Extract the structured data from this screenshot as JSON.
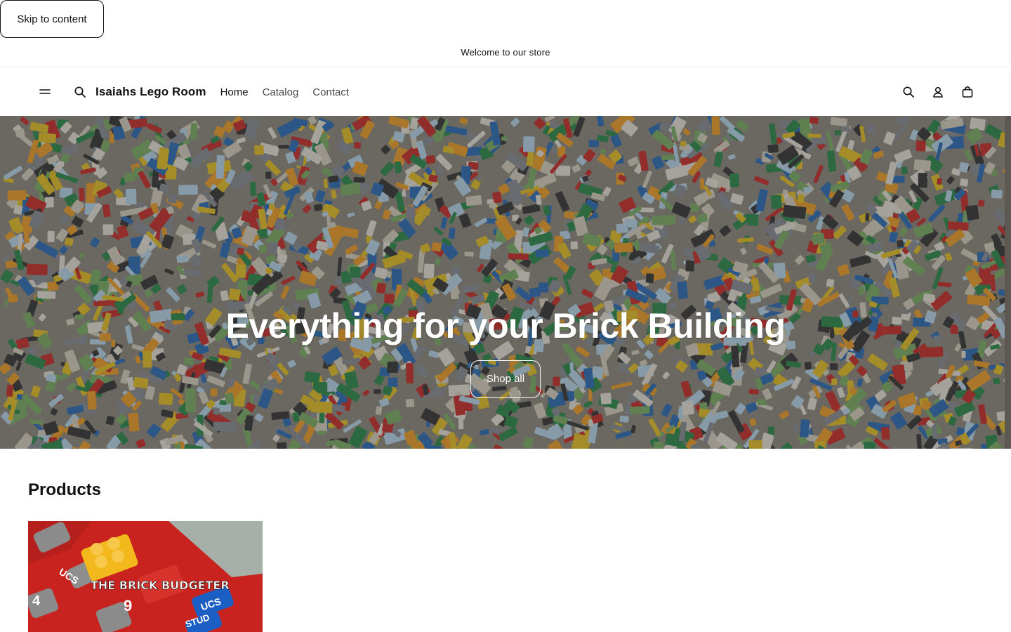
{
  "skip_link": "Skip to content",
  "announcement": "Welcome to our store",
  "header": {
    "brand": "Isaiahs Lego Room",
    "nav": [
      "Home",
      "Catalog",
      "Contact"
    ]
  },
  "hero": {
    "title": "Everything for your Brick Building",
    "button": "Shop all"
  },
  "products": {
    "title": "Products",
    "items": [
      {
        "image_text": "THE BRICK BUDGETER",
        "key_labels": [
          "UCS",
          "UCS",
          "STUD",
          "9",
          "4"
        ]
      }
    ]
  },
  "colors": {
    "text": "#121212",
    "hero_overlay": "#2b2b2b",
    "accent_red": "#c8231f"
  }
}
